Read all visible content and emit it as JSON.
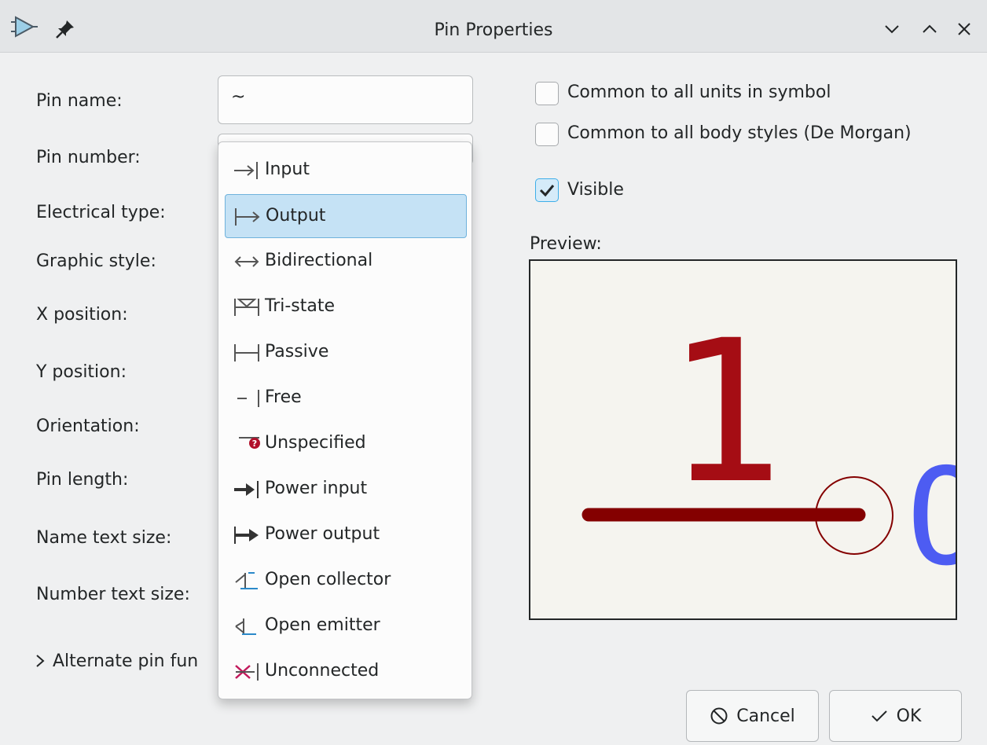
{
  "window": {
    "title": "Pin Properties",
    "app_icon": "kicad-symbol-editor-icon",
    "pin_icon": "pin-icon"
  },
  "form": {
    "pin_name_label": "Pin name:",
    "pin_name_value": "~",
    "pin_number_label": "Pin number:",
    "electrical_type_label": "Electrical type:",
    "graphic_style_label": "Graphic style:",
    "x_position_label": "X position:",
    "y_position_label": "Y position:",
    "orientation_label": "Orientation:",
    "pin_length_label": "Pin length:",
    "name_text_size_label": "Name text size:",
    "number_text_size_label": "Number text size:",
    "alternate_label": "Alternate pin fun"
  },
  "dropdown": {
    "selected": "Output",
    "options": [
      {
        "label": "Input",
        "icon": "input-pin-icon"
      },
      {
        "label": "Output",
        "icon": "output-pin-icon"
      },
      {
        "label": "Bidirectional",
        "icon": "bidirectional-pin-icon"
      },
      {
        "label": "Tri-state",
        "icon": "tri-state-pin-icon"
      },
      {
        "label": "Passive",
        "icon": "passive-pin-icon"
      },
      {
        "label": "Free",
        "icon": "free-pin-icon"
      },
      {
        "label": "Unspecified",
        "icon": "unspecified-pin-icon"
      },
      {
        "label": "Power input",
        "icon": "power-input-pin-icon"
      },
      {
        "label": "Power output",
        "icon": "power-output-pin-icon"
      },
      {
        "label": "Open collector",
        "icon": "open-collector-pin-icon"
      },
      {
        "label": "Open emitter",
        "icon": "open-emitter-pin-icon"
      },
      {
        "label": "Unconnected",
        "icon": "unconnected-pin-icon"
      }
    ]
  },
  "options": {
    "common_units_label": "Common to all units in symbol",
    "common_units_checked": false,
    "common_body_label": "Common to all body styles (De Morgan)",
    "common_body_checked": false,
    "visible_label": "Visible",
    "visible_checked": true
  },
  "preview": {
    "label": "Preview:",
    "pin_number": "1",
    "pin_name": "O"
  },
  "buttons": {
    "cancel": "Cancel",
    "ok": "OK"
  },
  "colors": {
    "selection_bg": "#c5e2f5",
    "selection_border": "#6fb2dc",
    "pin_red": "#a50d14",
    "pin_dark_red": "#840000",
    "pin_name_blue": "#4d5cf2",
    "checkbox_accent": "#3daee9"
  }
}
